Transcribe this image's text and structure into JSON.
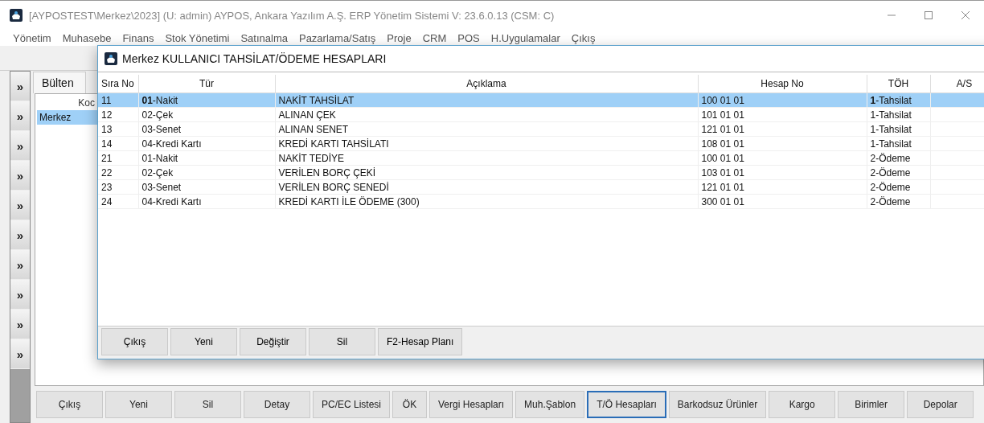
{
  "window": {
    "title": "[AYPOSTEST\\Merkez\\2023] (U: admin) AYPOS, Ankara Yazılım A.Ş. ERP Yönetim Sistemi V: 23.6.0.13 (CSM: C)"
  },
  "menu": [
    "Yönetim",
    "Muhasebe",
    "Finans",
    "Stok Yönetimi",
    "Satınalma",
    "Pazarlama/Satış",
    "Proje",
    "CRM",
    "POS",
    "H.Uygulamalar",
    "Çıkış"
  ],
  "side_strip": {
    "buttons": [
      "»",
      "»",
      "»",
      "»",
      "»",
      "»",
      "»",
      "»",
      "»",
      "»"
    ]
  },
  "tab": {
    "label": "Bülten"
  },
  "list": {
    "column": "Koc",
    "rows": [
      {
        "label": "Merkez",
        "selected": true
      }
    ]
  },
  "dialog": {
    "title": "Merkez KULLANICI TAHSİLAT/ÖDEME HESAPLARI",
    "columns": [
      "Sıra No",
      "Tür",
      "Açıklama",
      "Hesap No",
      "TÖH",
      "A/S"
    ],
    "rows": [
      {
        "cells": [
          "11",
          "**01**-Nakit",
          "NAKİT TAHSİLAT",
          "100 01 01",
          "**1**-Tahsilat",
          ""
        ],
        "selected": true
      },
      {
        "cells": [
          "12",
          "02-Çek",
          "ALINAN ÇEK",
          "101 01 01",
          "1-Tahsilat",
          ""
        ],
        "selected": false
      },
      {
        "cells": [
          "13",
          "03-Senet",
          "ALINAN SENET",
          "121 01 01",
          "1-Tahsilat",
          ""
        ],
        "selected": false
      },
      {
        "cells": [
          "14",
          "04-Kredi Kartı",
          "KREDİ KARTI TAHSİLATI",
          "108 01 01",
          "1-Tahsilat",
          ""
        ],
        "selected": false
      },
      {
        "cells": [
          "21",
          "01-Nakit",
          "NAKİT TEDİYE",
          "100 01 01",
          "2-Ödeme",
          ""
        ],
        "selected": false
      },
      {
        "cells": [
          "22",
          "02-Çek",
          "VERİLEN BORÇ ÇEKİ",
          "103 01 01",
          "2-Ödeme",
          ""
        ],
        "selected": false
      },
      {
        "cells": [
          "23",
          "03-Senet",
          "VERİLEN BORÇ SENEDİ",
          "121 01 01",
          "2-Ödeme",
          ""
        ],
        "selected": false
      },
      {
        "cells": [
          "24",
          "04-Kredi Kartı",
          "KREDİ KARTI İLE ÖDEME (300)",
          "300 01 01",
          "2-Ödeme",
          ""
        ],
        "selected": false
      }
    ],
    "buttons": [
      "Çıkış",
      "Yeni",
      "Değiştir",
      "Sil",
      "F2-Hesap Planı"
    ]
  },
  "buttons": [
    {
      "label": "Çıkış",
      "focused": false
    },
    {
      "label": "Yeni",
      "focused": false
    },
    {
      "label": "Sil",
      "focused": false
    },
    {
      "label": "Detay",
      "focused": false
    },
    {
      "label": "PC/EC Listesi",
      "focused": false
    },
    {
      "label": "ÖK",
      "focused": false
    },
    {
      "label": "Vergi Hesapları",
      "focused": false
    },
    {
      "label": "Muh.Şablon",
      "focused": false
    },
    {
      "label": "T/Ö Hesapları",
      "focused": true
    },
    {
      "label": "Barkodsuz Ürünler",
      "focused": false
    },
    {
      "label": "Kargo",
      "focused": false
    },
    {
      "label": "Birimler",
      "focused": false
    },
    {
      "label": "Depolar",
      "focused": false
    }
  ]
}
